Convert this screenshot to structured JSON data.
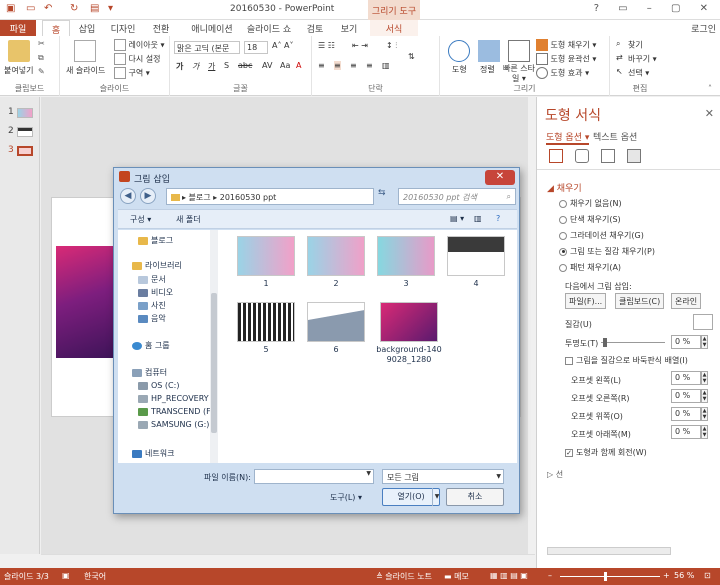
{
  "colors": {
    "accent": "#b7472a",
    "dialog_bg": "#cfdff1"
  },
  "titlebar": {
    "title": "20160530 - PowerPoint",
    "context_tools": "그리기 도구",
    "controls": "? ▭ – ▢ ✕"
  },
  "tabs": {
    "file": "파일",
    "home": "홈",
    "insert": "삽입",
    "design": "디자인",
    "transitions": "전환",
    "animations": "애니메이션",
    "slideshow": "슬라이드 쇼",
    "review": "검토",
    "view": "보기",
    "format": "서식",
    "login": "로그인"
  },
  "ribbon": {
    "paste": "붙여넣기",
    "clipboard": "클립보드",
    "new_slide": "새 슬라이드",
    "layout": "레이아웃 ▾",
    "reset": "다시 설정",
    "section": "구역 ▾",
    "slides": "슬라이드",
    "font_name": "맑은 고딕 (본문",
    "font_size": "18",
    "font_group": "글꼴",
    "paragraph": "단락",
    "shape": "도형",
    "arrange": "정렬",
    "quick_styles": "빠른 스타일 ▾",
    "shape_fill": "도형 채우기 ▾",
    "shape_outline": "도형 윤곽선 ▾",
    "shape_effects": "도형 효과 ▾",
    "drawing": "그리기",
    "find": "찾기",
    "replace": "바꾸기 ▾",
    "select": "선택 ▾",
    "editing": "편집"
  },
  "thumbs": [
    "1",
    "2",
    "3"
  ],
  "pane": {
    "title": "도형 서식",
    "close": "✕",
    "tab_shape": "도형 옵션 ▾",
    "tab_text": "텍스트 옵션",
    "fill_title": "◢ 채우기",
    "options": [
      {
        "label": "채우기 없음(N)",
        "on": false
      },
      {
        "label": "단색 채우기(S)",
        "on": false
      },
      {
        "label": "그라데이션 채우기(G)",
        "on": false
      },
      {
        "label": "그림 또는 질감 채우기(P)",
        "on": true
      },
      {
        "label": "패턴 채우기(A)",
        "on": false
      }
    ],
    "insert_from": "다음에서 그림 삽입:",
    "btn_file": "파일(F)...",
    "btn_clipboard": "클립보드(C)",
    "btn_online": "온라인",
    "texture": "질감(U)",
    "transparency": "투명도(T)",
    "transparency_val": "0 %",
    "tile_label": "그림을 질감으로 바둑판식 배열(I)",
    "offset_left": "오프셋 왼쪽(L)",
    "offset_left_val": "0 %",
    "offset_right": "오프셋 오른쪽(R)",
    "offset_right_val": "0 %",
    "offset_top": "오프셋 위쪽(O)",
    "offset_top_val": "0 %",
    "offset_bottom": "오프셋 아래쪽(M)",
    "offset_bottom_val": "0 %",
    "rotate_label": "도형과 함께 회전(W)",
    "line": "▷ 선"
  },
  "status": {
    "slide": "슬라이드 3/3",
    "lang": "한국어",
    "notes": "≜ 슬라이드 노트",
    "comments": "▬ 메모",
    "zoom": "56 %"
  },
  "dialog": {
    "title": "그림 삽입",
    "close": "✕",
    "address": "▸ 블로그 ▸ 20160530 ppt",
    "search": "20160530 ppt 검색",
    "organize": "구성 ▾",
    "new_folder": "새 폴더",
    "nav": [
      {
        "label": "블로그",
        "color": "#e8b84a"
      },
      {
        "label": "라이브러리",
        "color": "#e8b84a"
      },
      {
        "label": "문서",
        "color": "#b8c8dc"
      },
      {
        "label": "비디오",
        "color": "#6a7da0"
      },
      {
        "label": "사진",
        "color": "#7aa0c8"
      },
      {
        "label": "음악",
        "color": "#5a8ac0"
      },
      {
        "label": "홈 그룹",
        "color": "#3a8ad0"
      },
      {
        "label": "컴퓨터",
        "color": "#8aa0b8"
      },
      {
        "label": "OS (C:)",
        "color": "#8a9aaa"
      },
      {
        "label": "HP_RECOVERY (",
        "color": "#9aa8b4"
      },
      {
        "label": "TRANSCEND (F:)",
        "color": "#5a9a4a"
      },
      {
        "label": "SAMSUNG (G:)",
        "color": "#9aa8b4"
      },
      {
        "label": "네트워크",
        "color": "#3a7ac0"
      }
    ],
    "files": [
      {
        "name": "1",
        "bg": "linear-gradient(90deg,#9ad3e6,#f2a0c8)"
      },
      {
        "name": "2",
        "bg": "linear-gradient(90deg,#9ad3e6,#f0a0c8)"
      },
      {
        "name": "3",
        "bg": "linear-gradient(90deg,#86d8e0,#e89ac8)"
      },
      {
        "name": "4",
        "bg": "linear-gradient(180deg,#3a3a3a 40%,#ffffff 40%)"
      },
      {
        "name": "5",
        "bg": "repeating-linear-gradient(90deg,#222 0 3px,#fff 3px 5px)"
      },
      {
        "name": "6",
        "bg": "linear-gradient(170deg,#ffffff 35%,#8a9aae 36%)"
      },
      {
        "name": "background-1409028_1280",
        "bg": "linear-gradient(135deg,#d92a76,#5a1a6e)"
      }
    ],
    "filename_label": "파일 이름(N):",
    "filter": "모든 그림",
    "tools": "도구(L)  ▾",
    "open": "열기(O)",
    "cancel": "취소"
  }
}
